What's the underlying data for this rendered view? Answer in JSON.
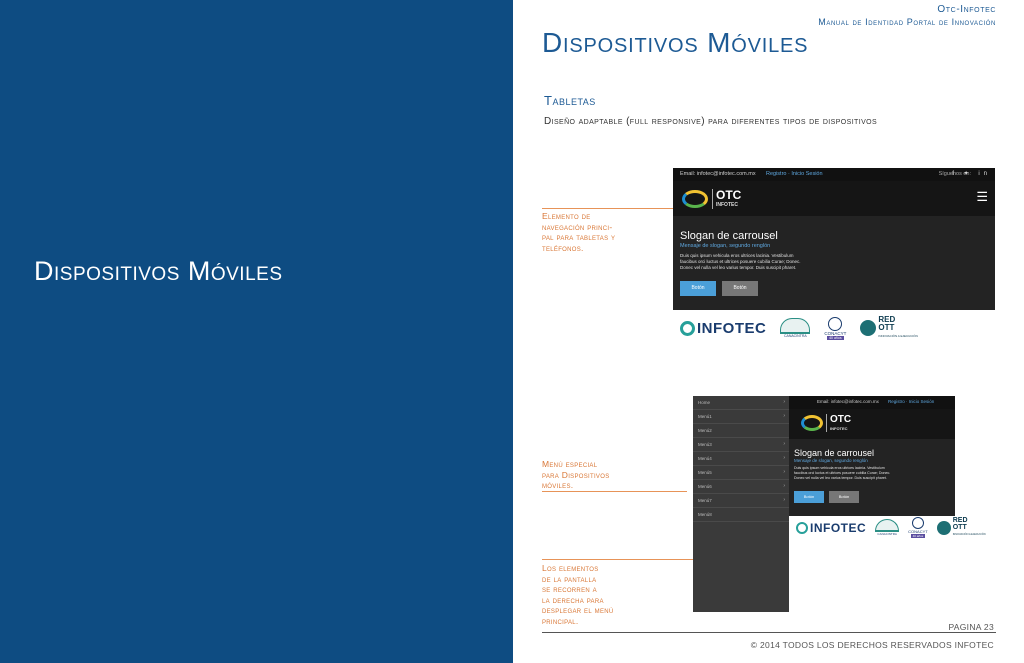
{
  "left": {
    "title": "Dispositivos Móviles"
  },
  "header": {
    "line1": "Otc-Infotec",
    "line2": "Manual de Identidad  Portal de  Innovación"
  },
  "page": {
    "title": "Dispositivos Móviles",
    "subtitle": "Tabletas",
    "description": "Diseño adaptable (full responsive) para diferentes tipos de dispositivos"
  },
  "notes": {
    "nav": [
      "Elemento de",
      "navegación princi-",
      "pal para tabletas y",
      "teléfonos."
    ],
    "menu": [
      "Menú especial",
      "para Dispositivos",
      "móviles."
    ],
    "slide": [
      "Los elementos",
      "de la pantalla",
      "se recorren a",
      "la derecha para",
      "desplegar el menú",
      "principal."
    ]
  },
  "mockup": {
    "email": "Email: infotec@infotec.com.mx",
    "register": "Registro · Inicio Sesión",
    "follow": "Síguenos en:",
    "social": "f  ✦  in",
    "logo_main": "OTC",
    "logo_sub": "INFOTEC",
    "slogan": "Slogan de carrousel",
    "slogan_sub": "Mensaje de slogan, segundo renglón",
    "lorem": [
      "Duis quis ipsum vehicula eros ultrices lacinia. Vestibulum",
      "faucibus orci luctus et ultrices posuere cubilia Curae; Donec.",
      "Donec vel nulla vel leo varius tempor. Duis suscipit pharet."
    ],
    "button1": "Botón",
    "button2": "Botón",
    "logos": {
      "infotec": "INFOTEC",
      "seal_text": "CANACINTRA",
      "conacyt": "CONACYT",
      "conacyt_sub": "40 años",
      "red1": "RED",
      "red2": "OTT",
      "red_sub": "INNOVACIÓN A EJECUCIÓN"
    }
  },
  "menu": [
    "Home",
    "Menú1",
    "Menú2",
    "Menú3",
    "Menú4",
    "Menú5",
    "Menú6",
    "Menú7",
    "Menú8"
  ],
  "footer": {
    "page": "PAGINA 23",
    "copyright": "© 2014 TODOS LOS DERECHOS RESERVADOS INFOTEC"
  }
}
